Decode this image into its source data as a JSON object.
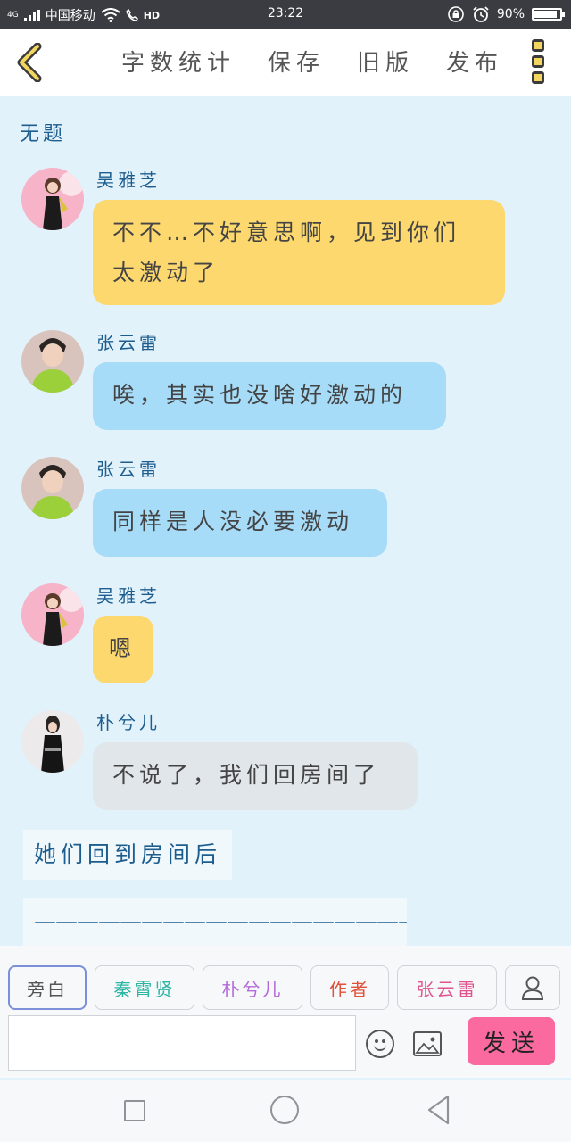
{
  "status_bar": {
    "network": "4G",
    "carrier": "中国移动",
    "hd": "HD",
    "time": "23:22",
    "battery": "90%",
    "battery_level": 0.9
  },
  "toolbar": {
    "word_count": "字数统计",
    "save": "保存",
    "old_version": "旧版",
    "publish": "发布"
  },
  "chat": {
    "title": "无题",
    "messages": [
      {
        "sender": "吴雅芝",
        "text": "不不…不好意思啊，见到你们太激动了",
        "color": "#fcd86e"
      },
      {
        "sender": "张云雷",
        "text": "唉，其实也没啥好激动的",
        "color": "#a6dcf8"
      },
      {
        "sender": "张云雷",
        "text": "同样是人没必要激动",
        "color": "#a6dcf8"
      },
      {
        "sender": "吴雅芝",
        "text": "嗯",
        "color": "#fcd86e"
      },
      {
        "sender": "朴兮儿",
        "text": "不说了，我们回房间了",
        "color": "#e1e6eb"
      }
    ],
    "narrations": [
      "她们回到房间后",
      "——————————————————"
    ]
  },
  "roles": [
    {
      "label": "旁白",
      "color": "#555555"
    },
    {
      "label": "秦霄贤",
      "color": "#2bb5a3"
    },
    {
      "label": "朴兮儿",
      "color": "#b46ad8"
    },
    {
      "label": "作者",
      "color": "#e0513a"
    },
    {
      "label": "张云雷",
      "color": "#e0558f"
    }
  ],
  "input": {
    "placeholder": "",
    "send_label": "发送"
  },
  "colors": {
    "accent_send": "#fb6a9e",
    "chat_background": "#e2f2fb",
    "name_color": "#1d5d8e"
  },
  "icons": [
    "back-chevron-icon",
    "more-icon",
    "user-icon",
    "emoji-icon",
    "image-icon",
    "nav-recent-icon",
    "nav-home-icon",
    "nav-back-icon"
  ]
}
